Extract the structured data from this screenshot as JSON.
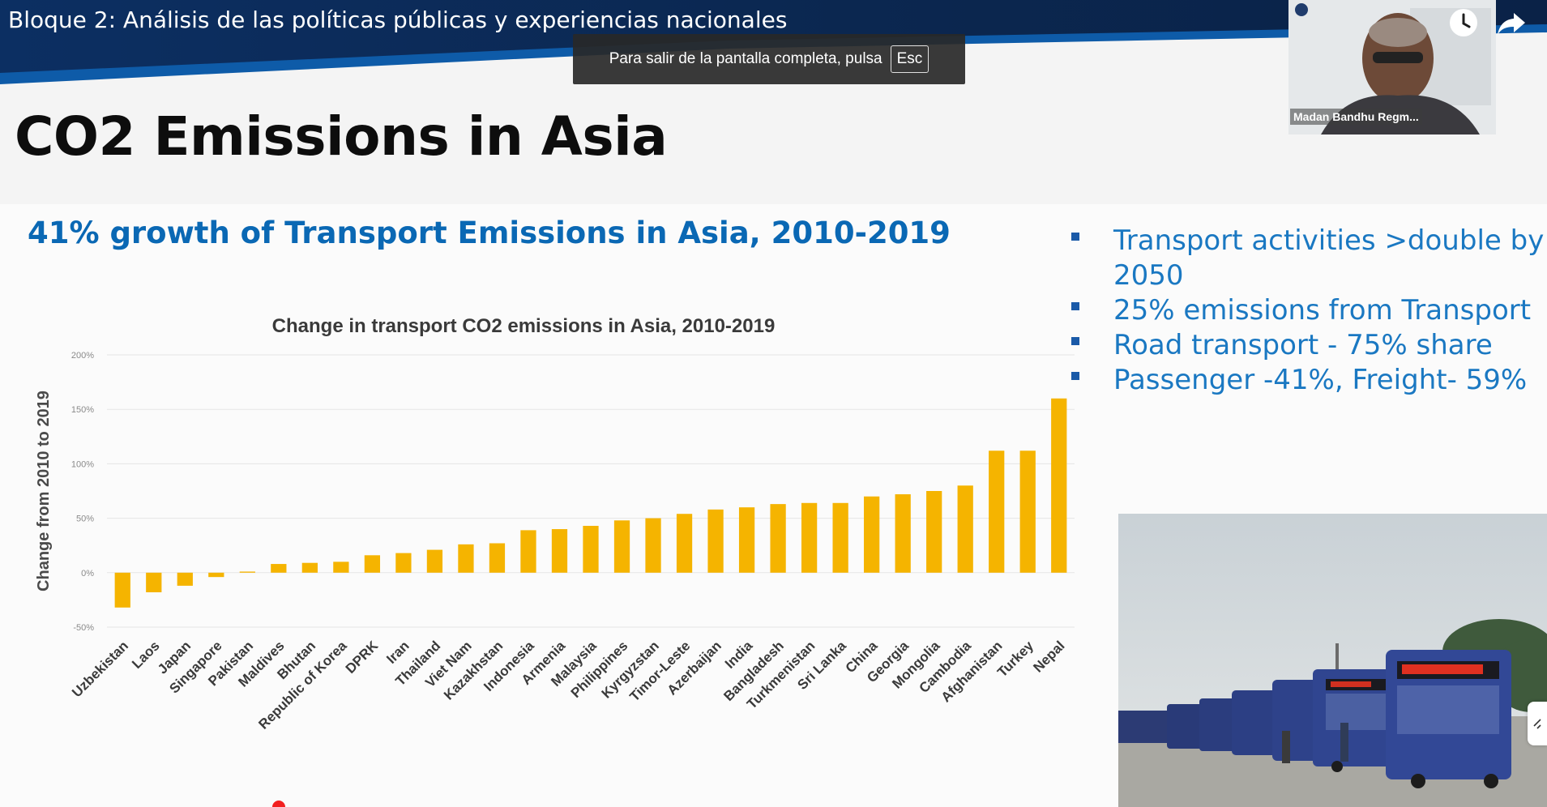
{
  "video": {
    "title": "Bloque 2: Análisis de las políticas públicas y experiencias nacionales"
  },
  "fullscreen_toast": {
    "text": "Para salir de la pantalla completa, pulsa",
    "key": "Esc"
  },
  "webcam": {
    "participant_name": "Madan Bandhu Regm..."
  },
  "controls": {
    "watch_later_icon": "clock-icon",
    "share_icon": "share-arrow-icon"
  },
  "slide": {
    "title": "CO2 Emissions in Asia",
    "subtitle": "41% growth of Transport Emissions in Asia, 2010-2019",
    "bullets": [
      "Transport activities >double by 2050",
      "25% emissions from Transport",
      "Road transport - 75% share",
      "Passenger -41%, Freight- 59%"
    ]
  },
  "chart_data": {
    "type": "bar",
    "title": "Change in transport CO2 emissions in Asia, 2010-2019",
    "xlabel": "",
    "ylabel": "Change from 2010 to 2019",
    "ylim": [
      -50,
      200
    ],
    "yticks": [
      -50,
      0,
      50,
      100,
      150,
      200
    ],
    "ytick_labels": [
      "-50%",
      "0%",
      "50%",
      "100%",
      "150%",
      "200%"
    ],
    "grid": true,
    "legend": "none",
    "bar_color": "#f5b400",
    "categories": [
      "Uzbekistan",
      "Laos",
      "Japan",
      "Singapore",
      "Pakistan",
      "Maldives",
      "Bhutan",
      "Republic of Korea",
      "DPRK",
      "Iran",
      "Thailand",
      "Viet Nam",
      "Kazakhstan",
      "Indonesia",
      "Armenia",
      "Malaysia",
      "Philippines",
      "Kyrgyzstan",
      "Timor-Leste",
      "Azerbaijan",
      "India",
      "Bangladesh",
      "Turkmenistan",
      "Sri Lanka",
      "China",
      "Georgia",
      "Mongolia",
      "Cambodia",
      "Afghanistan",
      "Turkey",
      "Nepal"
    ],
    "values": [
      -32,
      -18,
      -12,
      -4,
      1,
      8,
      9,
      10,
      16,
      18,
      21,
      26,
      27,
      39,
      40,
      43,
      48,
      50,
      54,
      58,
      60,
      63,
      64,
      64,
      70,
      72,
      75,
      80,
      112,
      112,
      160
    ]
  },
  "colors": {
    "band_dark": "#0b2750",
    "band_blue": "#0e5ba8",
    "subtitle_blue": "#0a68b4",
    "bullet_blue": "#1a78c2"
  }
}
